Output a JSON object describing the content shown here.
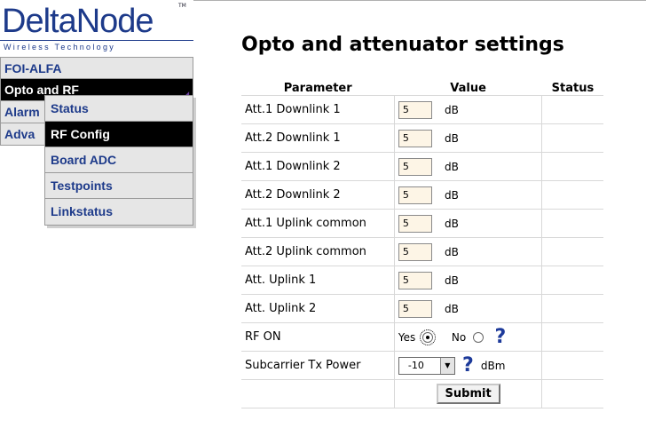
{
  "logo": {
    "brand": "DeltaNode",
    "tagline": "Wireless Technology",
    "tm": "TM"
  },
  "nav": {
    "items": [
      {
        "label": "FOI-ALFA"
      },
      {
        "label": "Opto and RF"
      },
      {
        "label": "Alarm"
      },
      {
        "label": "Adva"
      }
    ],
    "submenu": [
      {
        "label": "Status"
      },
      {
        "label": "RF Config"
      },
      {
        "label": "Board ADC"
      },
      {
        "label": "Testpoints"
      },
      {
        "label": "Linkstatus"
      }
    ]
  },
  "page": {
    "title": "Opto and attenuator settings"
  },
  "table": {
    "headers": {
      "parameter": "Parameter",
      "value": "Value",
      "status": "Status"
    },
    "rows": [
      {
        "label": "Att.1 Downlink 1",
        "value": "5",
        "unit": "dB"
      },
      {
        "label": "Att.2 Downlink 1",
        "value": "5",
        "unit": "dB"
      },
      {
        "label": "Att.1 Downlink 2",
        "value": "5",
        "unit": "dB"
      },
      {
        "label": "Att.2 Downlink 2",
        "value": "5",
        "unit": "dB"
      },
      {
        "label": "Att.1 Uplink common",
        "value": "5",
        "unit": "dB"
      },
      {
        "label": "Att.2 Uplink common",
        "value": "5",
        "unit": "dB"
      },
      {
        "label": "Att. Uplink 1",
        "value": "5",
        "unit": "dB"
      },
      {
        "label": "Att. Uplink 2",
        "value": "5",
        "unit": "dB"
      }
    ],
    "rf_on": {
      "label": "RF ON",
      "yes": "Yes",
      "no": "No",
      "selected": "Yes",
      "help": "?"
    },
    "subcarrier": {
      "label": "Subcarrier Tx Power",
      "value": "-10",
      "unit": "dBm",
      "help": "?"
    },
    "submit_label": "Submit"
  },
  "colors": {
    "brand_blue": "#1d3a8a",
    "menu_bg": "#e6e6e6",
    "active_bg": "#000000",
    "input_bg": "#fdf5e6"
  }
}
